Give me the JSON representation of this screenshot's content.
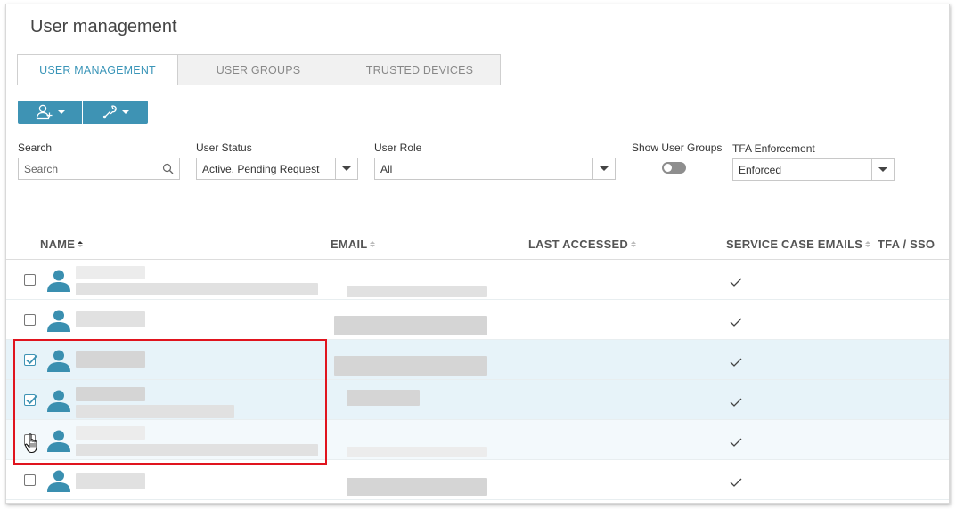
{
  "page": {
    "title": "User management"
  },
  "tabs": [
    {
      "label": "USER MANAGEMENT",
      "active": true
    },
    {
      "label": "USER GROUPS",
      "active": false
    },
    {
      "label": "TRUSTED DEVICES",
      "active": false
    }
  ],
  "toolbar": {
    "add_user_icon": "user-add-icon",
    "tools_icon": "wrench-icon"
  },
  "filters": {
    "search": {
      "label": "Search",
      "placeholder": "Search"
    },
    "user_status": {
      "label": "User Status",
      "value": "Active, Pending Request"
    },
    "user_role": {
      "label": "User Role",
      "value": "All"
    },
    "show_user_groups": {
      "label": "Show User Groups",
      "on": false
    },
    "tfa_enforcement": {
      "label": "TFA Enforcement",
      "value": "Enforced"
    }
  },
  "table": {
    "columns": {
      "name": "NAME",
      "email": "EMAIL",
      "last_accessed": "LAST ACCESSED",
      "service_case_emails": "SERVICE CASE EMAILS",
      "tfa_sso": "TFA / SSO"
    },
    "sort": {
      "column": "name",
      "direction": "asc"
    },
    "rows": [
      {
        "checked": false,
        "service_case_emails": true
      },
      {
        "checked": false,
        "service_case_emails": true
      },
      {
        "checked": true,
        "service_case_emails": true
      },
      {
        "checked": true,
        "service_case_emails": true
      },
      {
        "checked": false,
        "service_case_emails": true
      },
      {
        "checked": false,
        "service_case_emails": true
      }
    ]
  },
  "colors": {
    "accent": "#3e93b4",
    "selected_row": "#e7f3f9",
    "highlight": "#e0141e"
  }
}
